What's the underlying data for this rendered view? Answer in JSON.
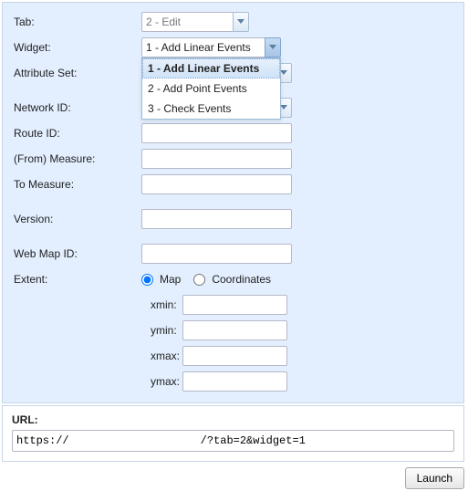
{
  "form": {
    "tab": {
      "label": "Tab:",
      "value": "2 - Edit"
    },
    "widget": {
      "label": "Widget:",
      "value": "1 - Add Linear Events",
      "options": [
        "1 - Add Linear Events",
        "2 - Add Point Events",
        "3 - Check Events"
      ]
    },
    "attribute_set": {
      "label": "Attribute Set:",
      "value": ""
    },
    "network_id": {
      "label": "Network ID:",
      "value": ""
    },
    "route_id": {
      "label": "Route ID:",
      "value": ""
    },
    "from_measure": {
      "label": "(From) Measure:",
      "value": ""
    },
    "to_measure": {
      "label": "To Measure:",
      "value": ""
    },
    "version": {
      "label": "Version:",
      "value": ""
    },
    "web_map_id": {
      "label": "Web Map ID:",
      "value": ""
    },
    "extent": {
      "label": "Extent:",
      "radio_map": "Map",
      "radio_coords": "Coordinates",
      "selected": "map",
      "xmin": {
        "label": "xmin:",
        "value": ""
      },
      "ymin": {
        "label": "ymin:",
        "value": ""
      },
      "xmax": {
        "label": "xmax:",
        "value": ""
      },
      "ymax": {
        "label": "ymax:",
        "value": ""
      }
    }
  },
  "url": {
    "label": "URL:",
    "value": "https://                    /?tab=2&widget=1"
  },
  "launch_label": "Launch"
}
